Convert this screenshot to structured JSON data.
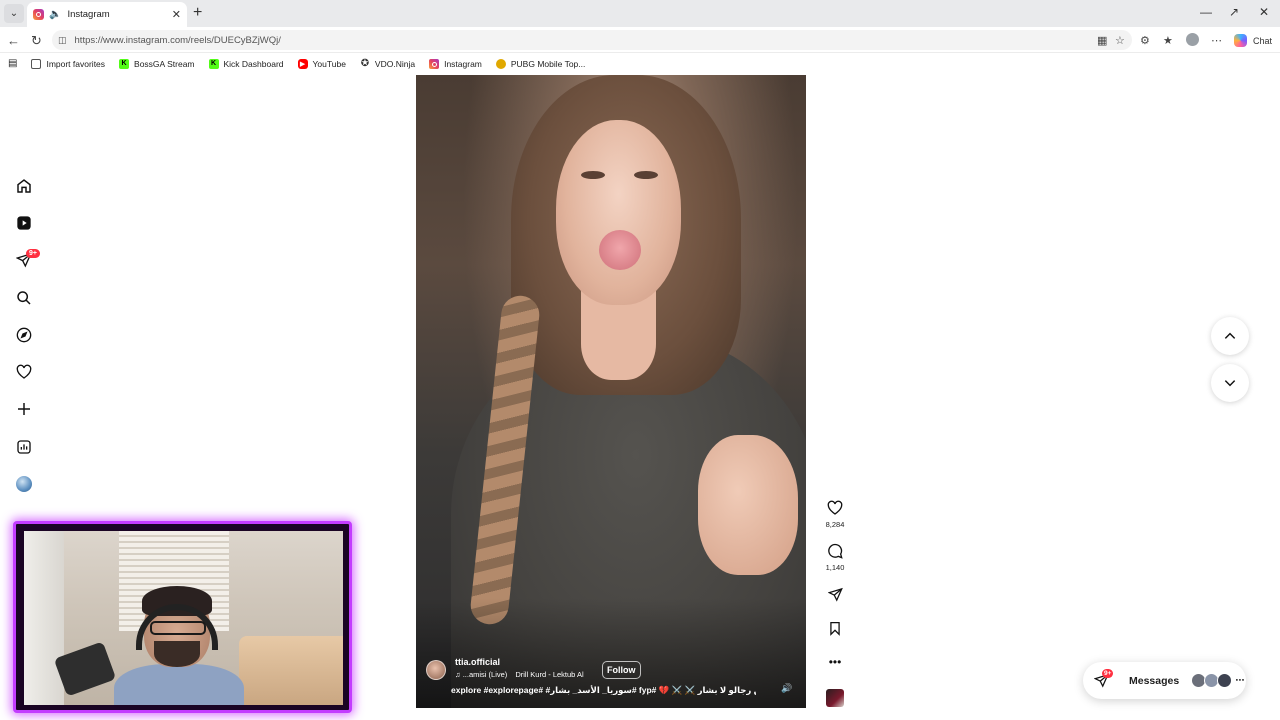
{
  "browser": {
    "tab_title": "Instagram",
    "url": "https://www.instagram.com/reels/DUECyBZjWQj/",
    "chat_label": "Chat",
    "favorites": [
      {
        "label": "Import favorites",
        "icon": "folder-icon"
      },
      {
        "label": "BossGA Stream",
        "icon": "kick-icon",
        "color": "#53fc18"
      },
      {
        "label": "Kick Dashboard",
        "icon": "kick-icon",
        "color": "#53fc18"
      },
      {
        "label": "YouTube",
        "icon": "youtube-icon",
        "color": "#ff0000"
      },
      {
        "label": "VDO.Ninja",
        "icon": "ninja-icon"
      },
      {
        "label": "Instagram",
        "icon": "instagram-icon"
      },
      {
        "label": "PUBG Mobile Top...",
        "icon": "pubg-icon"
      }
    ]
  },
  "sidebar": {
    "items": [
      "home-icon",
      "reels-icon",
      "direct-icon",
      "search-icon",
      "explore-icon",
      "notifications-icon",
      "create-icon",
      "dashboard-icon",
      "profile-icon"
    ],
    "direct_badge": "9+"
  },
  "reel": {
    "username": "ttia.official",
    "audio_artist": "♫  ...amisi (Live)",
    "audio_track": "Drill Kurd - Lektub Al",
    "follow_label": "Follow",
    "caption": "explore #explorepage# #سوريا_ الأسد_ بشار# fyp# 💔 ⚔️ ⚔️ وين رجالو لا بشار",
    "likes": "8,284",
    "comments": "1,140"
  },
  "messages": {
    "label": "Messages",
    "badge": "9+"
  },
  "colors": {
    "accent_badge": "#ff3040",
    "webcam_border": "#c33cff"
  }
}
